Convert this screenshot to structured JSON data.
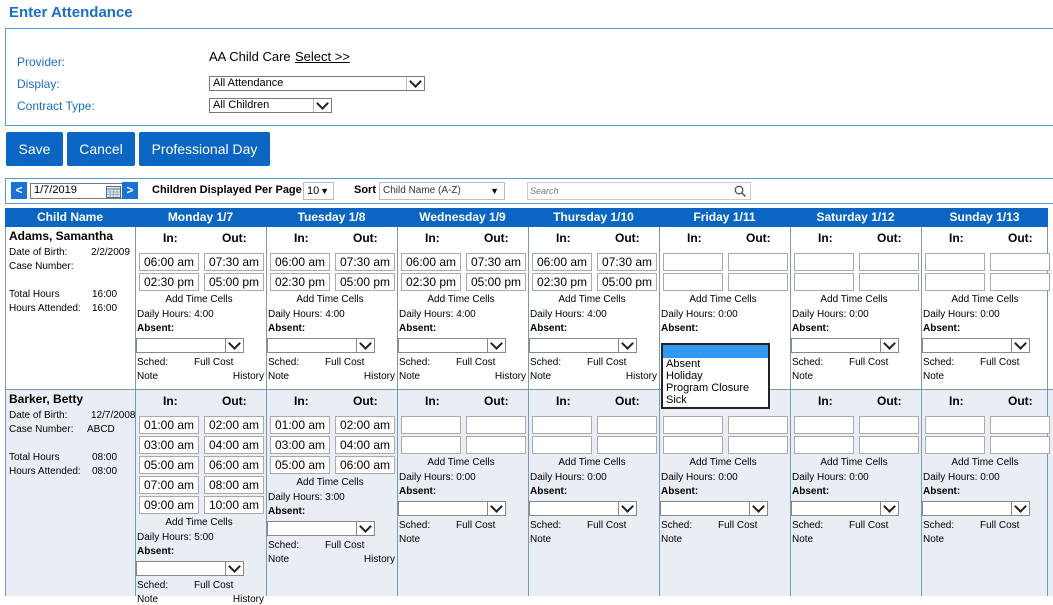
{
  "page": {
    "title": "Enter Attendance"
  },
  "filters": {
    "provider_label": "Provider:",
    "provider_name": "AA Child Care",
    "provider_select": "Select >>",
    "display_label": "Display:",
    "display_value": "All Attendance",
    "contract_label": "Contract Type:",
    "contract_value": "All Children"
  },
  "buttons": {
    "save": "Save",
    "cancel": "Cancel",
    "professional_day": "Professional Day"
  },
  "toolbar": {
    "date": "1/7/2019",
    "per_page_label": "Children Displayed Per Page",
    "per_page_value": "10",
    "sort_label": "Sort",
    "sort_value": "Child Name (A-Z)",
    "search_placeholder": "Search"
  },
  "columns": [
    "Child Name",
    "Monday 1/7",
    "Tuesday 1/8",
    "Wednesday 1/9",
    "Thursday 1/10",
    "Friday 1/11",
    "Saturday 1/12",
    "Sunday 1/13"
  ],
  "labels": {
    "in": "In:",
    "out": "Out:",
    "add": "Add Time Cells",
    "absent": "Absent:",
    "sched": "Sched:",
    "full_cost": "Full Cost",
    "note": "Note",
    "history": "History",
    "dob": "Date of Birth:",
    "case": "Case Number:",
    "total": "Total Hours",
    "attended": "Hours Attended:"
  },
  "absent_options": [
    "Absent",
    "Holiday",
    "Program Closure",
    "Sick"
  ],
  "children": [
    {
      "name": "Adams, Samantha",
      "dob": "2/2/2009",
      "case": "",
      "total": "16:00",
      "attended": "16:00",
      "days": [
        {
          "times": [
            [
              "06:00 am",
              "07:30 am"
            ],
            [
              "02:30 pm",
              "05:00 pm"
            ]
          ],
          "daily": "Daily Hours: 4:00"
        },
        {
          "times": [
            [
              "06:00 am",
              "07:30 am"
            ],
            [
              "02:30 pm",
              "05:00 pm"
            ]
          ],
          "daily": "Daily Hours: 4:00"
        },
        {
          "times": [
            [
              "06:00 am",
              "07:30 am"
            ],
            [
              "02:30 pm",
              "05:00 pm"
            ]
          ],
          "daily": "Daily Hours: 4:00"
        },
        {
          "times": [
            [
              "06:00 am",
              "07:30 am"
            ],
            [
              "02:30 pm",
              "05:00 pm"
            ]
          ],
          "daily": "Daily Hours: 4:00"
        },
        {
          "times": [
            [
              "",
              ""
            ],
            [
              "",
              ""
            ]
          ],
          "daily": "Daily Hours: 0:00"
        },
        {
          "times": [
            [
              "",
              ""
            ],
            [
              "",
              ""
            ]
          ],
          "daily": "Daily Hours: 0:00"
        },
        {
          "times": [
            [
              "",
              ""
            ],
            [
              "",
              ""
            ]
          ],
          "daily": "Daily Hours: 0:00"
        }
      ]
    },
    {
      "name": "Barker, Betty",
      "dob": "12/7/2008",
      "case": "ABCD",
      "total": "08:00",
      "attended": "08:00",
      "days": [
        {
          "times": [
            [
              "01:00 am",
              "02:00 am"
            ],
            [
              "03:00 am",
              "04:00 am"
            ],
            [
              "05:00 am",
              "06:00 am"
            ],
            [
              "07:00 am",
              "08:00 am"
            ],
            [
              "09:00 am",
              "10:00 am"
            ]
          ],
          "daily": "Daily Hours: 5:00"
        },
        {
          "times": [
            [
              "01:00 am",
              "02:00 am"
            ],
            [
              "03:00 am",
              "04:00 am"
            ],
            [
              "05:00 am",
              "06:00 am"
            ]
          ],
          "daily": "Daily Hours: 3:00"
        },
        {
          "times": [
            [
              "",
              ""
            ],
            [
              "",
              ""
            ]
          ],
          "daily": "Daily Hours: 0:00"
        },
        {
          "times": [
            [
              "",
              ""
            ],
            [
              "",
              ""
            ]
          ],
          "daily": "Daily Hours: 0:00"
        },
        {
          "times": [
            [
              "",
              ""
            ],
            [
              "",
              ""
            ]
          ],
          "daily": "Daily Hours: 0:00"
        },
        {
          "times": [
            [
              "",
              ""
            ],
            [
              "",
              ""
            ]
          ],
          "daily": "Daily Hours: 0:00"
        },
        {
          "times": [
            [
              "",
              ""
            ],
            [
              "",
              ""
            ]
          ],
          "daily": "Daily Hours: 0:00"
        }
      ]
    }
  ],
  "colors": {
    "accent": "#0a66c2",
    "label": "#1a6fc4",
    "row_alt": "#e8eef4"
  }
}
